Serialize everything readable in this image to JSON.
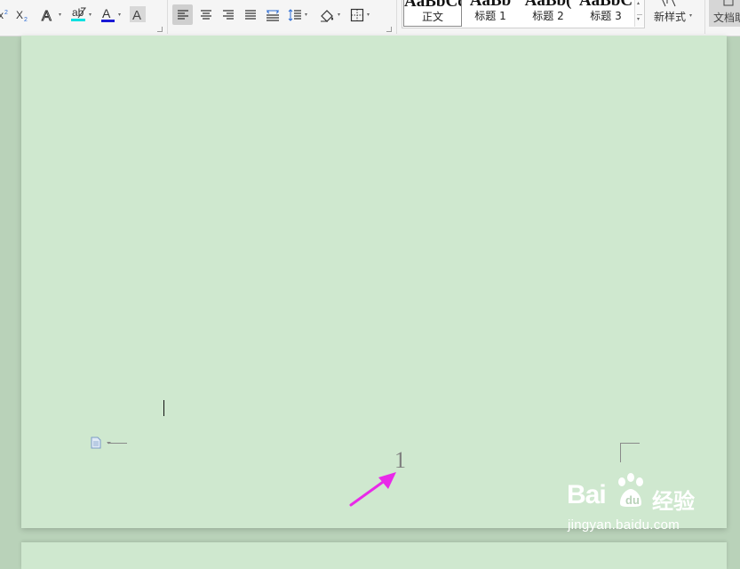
{
  "ribbon": {
    "styles": [
      {
        "preview": "AaBbCcDd",
        "label": "正文",
        "active": true
      },
      {
        "preview": "AaBb",
        "label": "标题 1",
        "active": false
      },
      {
        "preview": "AaBb(",
        "label": "标题 2",
        "active": false
      },
      {
        "preview": "AaBbC",
        "label": "标题 3",
        "active": false
      }
    ],
    "new_style_label": "新样式",
    "doc_button_label": "文档助"
  },
  "document": {
    "page_number": "1"
  },
  "watermark": {
    "brand": "Bai",
    "brand_cn": "经验",
    "url": "jingyan.baidu.com"
  }
}
